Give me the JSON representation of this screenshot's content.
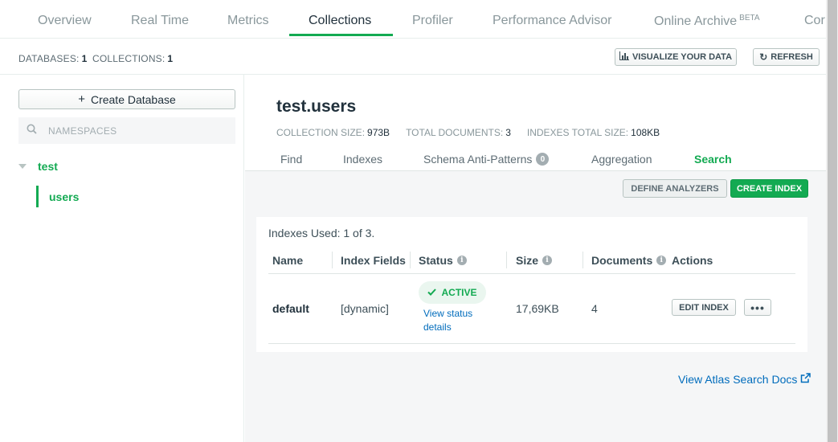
{
  "topnav": {
    "tabs": [
      {
        "label": "Overview"
      },
      {
        "label": "Real Time"
      },
      {
        "label": "Metrics"
      },
      {
        "label": "Collections"
      },
      {
        "label": "Profiler"
      },
      {
        "label": "Performance Advisor"
      },
      {
        "label": "Online Archive",
        "badge": "BETA"
      },
      {
        "label": "Cor"
      }
    ],
    "active_tab": "Collections"
  },
  "stats": {
    "databases_label": "DATABASES:",
    "databases_value": "1",
    "collections_label": "COLLECTIONS:",
    "collections_value": "1",
    "visualize_label": "VISUALIZE YOUR DATA",
    "refresh_label": "REFRESH"
  },
  "sidebar": {
    "create_database_label": "Create Database",
    "search_placeholder": "NAMESPACES",
    "databases": [
      {
        "name": "test",
        "collections": [
          "users"
        ]
      }
    ]
  },
  "collection": {
    "title": "test.users",
    "size_label": "COLLECTION SIZE:",
    "size_value": "973B",
    "docs_label": "TOTAL DOCUMENTS:",
    "docs_value": "3",
    "indexes_size_label": "INDEXES TOTAL SIZE:",
    "indexes_size_value": "108KB"
  },
  "subtabs": {
    "items": [
      {
        "label": "Find"
      },
      {
        "label": "Indexes"
      },
      {
        "label": "Schema Anti-Patterns",
        "badge": "0"
      },
      {
        "label": "Aggregation"
      },
      {
        "label": "Search"
      }
    ],
    "active": "Search"
  },
  "search_panel": {
    "define_analyzers_label": "DEFINE ANALYZERS",
    "create_index_label": "CREATE INDEX",
    "indexes_used": "Indexes Used: 1 of 3.",
    "columns": [
      "Name",
      "Index Fields",
      "Status",
      "Size",
      "Documents",
      "Actions"
    ],
    "rows": [
      {
        "name": "default",
        "index_fields": "[dynamic]",
        "status": "ACTIVE",
        "status_link": "View status details",
        "size": "17,69KB",
        "documents": "4",
        "edit_label": "EDIT INDEX",
        "more_label": "•••"
      }
    ],
    "docs_link": "View Atlas Search Docs"
  },
  "colors": {
    "accent_green": "#13aa52",
    "link_blue": "#006cbc",
    "panel_grey": "#f5f6f7"
  }
}
